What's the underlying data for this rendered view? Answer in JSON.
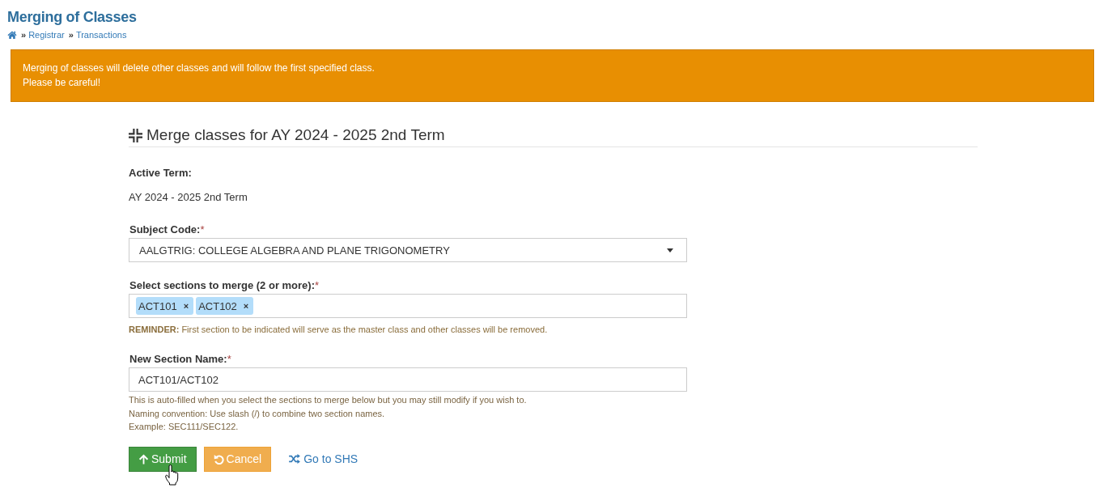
{
  "page_header": {
    "title": "Merging of Classes",
    "breadcrumb": [
      {
        "kind": "home"
      },
      {
        "kind": "link",
        "separator": "»",
        "label": "Registrar"
      },
      {
        "kind": "link",
        "separator": "»",
        "label": "Transactions"
      }
    ]
  },
  "alert": {
    "lines": [
      "Merging of classes will delete other classes and will follow the first specified class.",
      "Please be careful!"
    ]
  },
  "form": {
    "heading": "Merge classes for AY 2024 - 2025 2nd Term",
    "info": {
      "label": "Active Term:",
      "value": "AY 2024 - 2025 2nd Term"
    },
    "fields": [
      {
        "kind": "select",
        "label": "Subject Code:",
        "required_mark": "*",
        "value": "AALGTRIG: COLLEGE ALGEBRA AND PLANE TRIGONOMETRY"
      },
      {
        "kind": "tags",
        "label": "Select sections to merge (2 or more):",
        "required_mark": "*",
        "tags": [
          {
            "label": "ACT101",
            "remove": "×"
          },
          {
            "label": "ACT102",
            "remove": "×"
          }
        ],
        "help": [
          "**REMINDER:** First section to be indicated will serve as the master class and other classes will be removed."
        ]
      },
      {
        "kind": "text",
        "label": "New Section Name:",
        "required_mark": "*",
        "value": "ACT101/ACT102",
        "help": [
          "This is auto-filled when you select the sections to merge below but you may still modify if you wish to.",
          "Naming convention: Use slash (/) to combine two section names.",
          "Example: SEC111/SEC122."
        ]
      }
    ],
    "buttons": [
      {
        "kind": "submit",
        "label": "Submit"
      },
      {
        "kind": "cancel",
        "label": "Cancel"
      },
      {
        "kind": "link",
        "label": "Go to SHS"
      }
    ]
  }
}
